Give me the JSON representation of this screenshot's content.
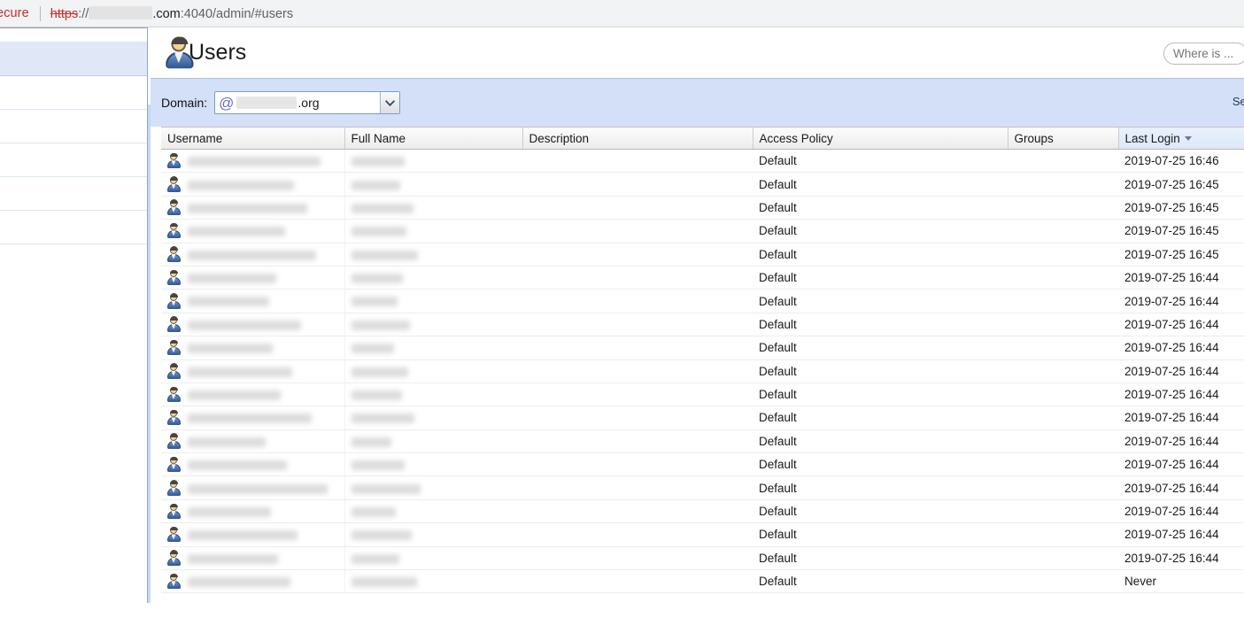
{
  "browser": {
    "security_label": "ecure",
    "url": {
      "scheme": "https",
      "separator": "://",
      "host_redacted": true,
      "tld": ".com",
      "path": ":4040/admin/#users"
    }
  },
  "header": {
    "title": "Users",
    "avatar_icon": "user-icon",
    "search_placeholder": "Where is ..."
  },
  "toolbar": {
    "domain_label": "Domain:",
    "at_icon": "@",
    "domain_name_redacted": true,
    "domain_tld": ".org",
    "dropdown_icon": "chevron-down-icon",
    "search_label": "Sea"
  },
  "table": {
    "columns": [
      {
        "key": "username",
        "label": "Username",
        "sorted": false
      },
      {
        "key": "fullname",
        "label": "Full Name",
        "sorted": false
      },
      {
        "key": "description",
        "label": "Description",
        "sorted": false
      },
      {
        "key": "policy",
        "label": "Access Policy",
        "sorted": false
      },
      {
        "key": "groups",
        "label": "Groups",
        "sorted": false
      },
      {
        "key": "lastlogin",
        "label": "Last Login",
        "sorted": true,
        "sort_direction": "desc"
      }
    ],
    "rows": [
      {
        "username": "",
        "fullname": "",
        "description": "",
        "policy": "Default",
        "groups": "",
        "lastlogin": "2019-07-25 16:46",
        "redacted": true,
        "uw": 150,
        "fw": 60
      },
      {
        "username": "",
        "fullname": "",
        "description": "",
        "policy": "Default",
        "groups": "",
        "lastlogin": "2019-07-25 16:45",
        "redacted": true,
        "uw": 120,
        "fw": 55
      },
      {
        "username": "",
        "fullname": "",
        "description": "",
        "policy": "Default",
        "groups": "",
        "lastlogin": "2019-07-25 16:45",
        "redacted": true,
        "uw": 135,
        "fw": 70
      },
      {
        "username": "",
        "fullname": "",
        "description": "",
        "policy": "Default",
        "groups": "",
        "lastlogin": "2019-07-25 16:45",
        "redacted": true,
        "uw": 110,
        "fw": 62
      },
      {
        "username": "",
        "fullname": "",
        "description": "",
        "policy": "Default",
        "groups": "",
        "lastlogin": "2019-07-25 16:45",
        "redacted": true,
        "uw": 145,
        "fw": 75
      },
      {
        "username": "",
        "fullname": "",
        "description": "",
        "policy": "Default",
        "groups": "",
        "lastlogin": "2019-07-25 16:44",
        "redacted": true,
        "uw": 100,
        "fw": 58
      },
      {
        "username": "",
        "fullname": "",
        "description": "",
        "policy": "Default",
        "groups": "",
        "lastlogin": "2019-07-25 16:44",
        "redacted": true,
        "uw": 92,
        "fw": 52
      },
      {
        "username": "",
        "fullname": "",
        "description": "",
        "policy": "Default",
        "groups": "",
        "lastlogin": "2019-07-25 16:44",
        "redacted": true,
        "uw": 128,
        "fw": 66
      },
      {
        "username": "",
        "fullname": "",
        "description": "",
        "policy": "Default",
        "groups": "",
        "lastlogin": "2019-07-25 16:44",
        "redacted": true,
        "uw": 96,
        "fw": 48
      },
      {
        "username": "",
        "fullname": "",
        "description": "",
        "policy": "Default",
        "groups": "",
        "lastlogin": "2019-07-25 16:44",
        "redacted": true,
        "uw": 118,
        "fw": 64
      },
      {
        "username": "",
        "fullname": "",
        "description": "",
        "policy": "Default",
        "groups": "",
        "lastlogin": "2019-07-25 16:44",
        "redacted": true,
        "uw": 105,
        "fw": 57
      },
      {
        "username": "",
        "fullname": "",
        "description": "",
        "policy": "Default",
        "groups": "",
        "lastlogin": "2019-07-25 16:44",
        "redacted": true,
        "uw": 140,
        "fw": 71
      },
      {
        "username": "",
        "fullname": "",
        "description": "",
        "policy": "Default",
        "groups": "",
        "lastlogin": "2019-07-25 16:44",
        "redacted": true,
        "uw": 88,
        "fw": 45
      },
      {
        "username": "",
        "fullname": "",
        "description": "",
        "policy": "Default",
        "groups": "",
        "lastlogin": "2019-07-25 16:44",
        "redacted": true,
        "uw": 112,
        "fw": 60
      },
      {
        "username": "",
        "fullname": "",
        "description": "",
        "policy": "Default",
        "groups": "",
        "lastlogin": "2019-07-25 16:44",
        "redacted": true,
        "uw": 158,
        "fw": 78
      },
      {
        "username": "",
        "fullname": "",
        "description": "",
        "policy": "Default",
        "groups": "",
        "lastlogin": "2019-07-25 16:44",
        "redacted": true,
        "uw": 94,
        "fw": 50
      },
      {
        "username": "",
        "fullname": "",
        "description": "",
        "policy": "Default",
        "groups": "",
        "lastlogin": "2019-07-25 16:44",
        "redacted": true,
        "uw": 124,
        "fw": 68
      },
      {
        "username": "",
        "fullname": "",
        "description": "",
        "policy": "Default",
        "groups": "",
        "lastlogin": "2019-07-25 16:44",
        "redacted": true,
        "uw": 102,
        "fw": 54
      },
      {
        "username": "",
        "fullname": "",
        "description": "",
        "policy": "Default",
        "groups": "",
        "lastlogin": "Never",
        "redacted": true,
        "uw": 116,
        "fw": 74
      }
    ]
  },
  "sidebar": {
    "items": [
      {
        "label": "",
        "active": false
      },
      {
        "label": "",
        "active": true
      },
      {
        "label": "",
        "active": false
      },
      {
        "label": "",
        "active": false
      },
      {
        "label": "",
        "active": false
      },
      {
        "label": "",
        "active": false
      },
      {
        "label": "",
        "active": false
      }
    ]
  },
  "colors": {
    "toolbar_band": "#d3e0f7",
    "sidebar_rail": "#c5d8f5",
    "sort_header": "#dbe7f8",
    "security_red": "#cc2c24",
    "at_purple": "#6b6fc4"
  }
}
